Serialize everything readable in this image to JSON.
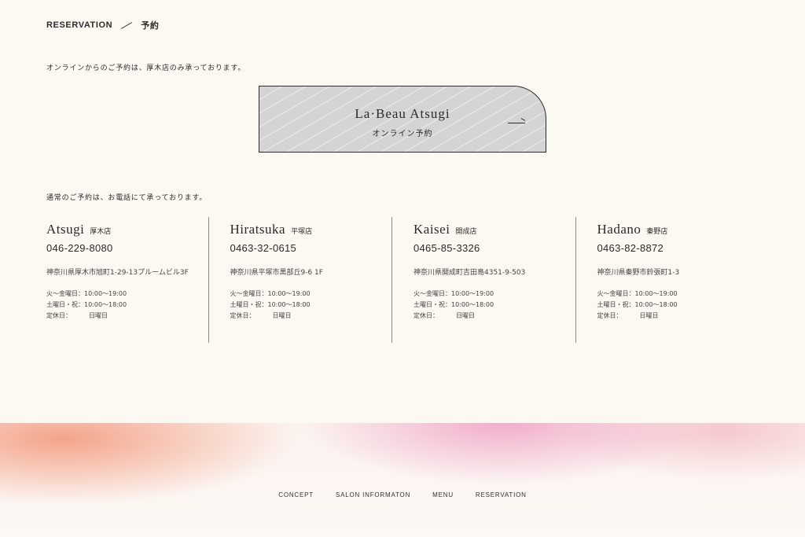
{
  "section": {
    "title_en": "RESERVATION",
    "title_jp": "予約"
  },
  "online": {
    "intro": "オンラインからのご予約は、厚木店のみ承っております。",
    "card_salon": "La·Beau Atsugi",
    "card_label": "オンライン予約",
    "arrow_icon": "arrow-right-icon"
  },
  "phone_intro": "通常のご予約は、お電話にて承っております。",
  "stores": [
    {
      "name": "Atsugi",
      "jp_name": "厚木店",
      "phone": "046-229-8080",
      "address": "神奈川県厚木市旭町1-29-13プルームビル3F",
      "hours_weekday": "火〜金曜日：10:00〜19:00",
      "hours_weekend": "土曜日・祝：10:00〜18:00",
      "closed_label": "定休日：",
      "closed_day": "日曜日"
    },
    {
      "name": "Hiratsuka",
      "jp_name": "平塚店",
      "phone": "0463-32-0615",
      "address": "神奈川県平塚市黒部丘9-6 1F",
      "hours_weekday": "火〜金曜日：10:00〜19:00",
      "hours_weekend": "土曜日・祝：10:00〜18:00",
      "closed_label": "定休日：",
      "closed_day": "日曜日"
    },
    {
      "name": "Kaisei",
      "jp_name": "開成店",
      "phone": "0465-85-3326",
      "address": "神奈川県開成町吉田島4351-9-503",
      "hours_weekday": "火〜金曜日：10:00〜19:00",
      "hours_weekend": "土曜日・祝：10:00〜18:00",
      "closed_label": "定休日：",
      "closed_day": "日曜日"
    },
    {
      "name": "Hadano",
      "jp_name": "秦野店",
      "phone": "0463-82-8872",
      "address": "神奈川県秦野市鈴張町1-3",
      "hours_weekday": "火〜金曜日：10:00〜19:00",
      "hours_weekend": "土曜日・祝：10:00〜18:00",
      "closed_label": "定休日：",
      "closed_day": "日曜日"
    }
  ],
  "footer": {
    "nav": [
      "CONCEPT",
      "SALON INFORMATON",
      "MENU",
      "RESERVATION"
    ]
  },
  "colors": {
    "background": "#fcf9f3",
    "text": "#2b2b2b",
    "card_fill": "#d4d4d4"
  }
}
